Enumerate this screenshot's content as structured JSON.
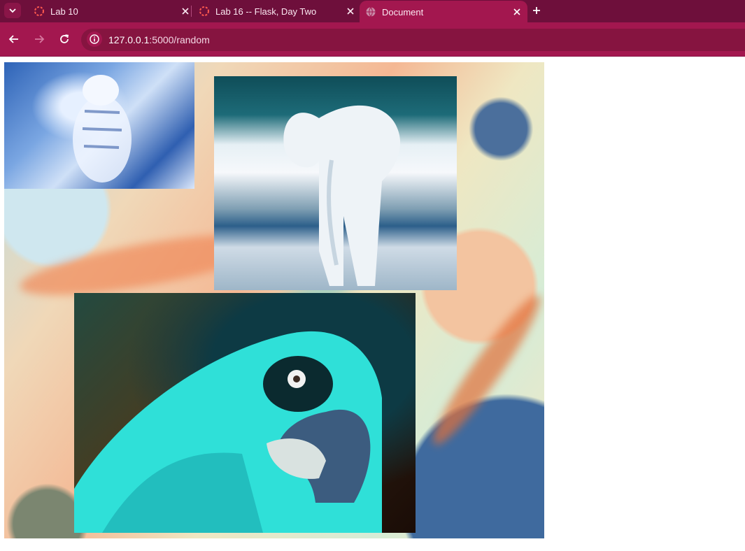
{
  "browser": {
    "tabs": [
      {
        "title": "Lab 10",
        "active": false,
        "favicon": "loading-ring-icon"
      },
      {
        "title": "Lab 16 -- Flask, Day Two",
        "active": false,
        "favicon": "loading-ring-icon"
      },
      {
        "title": "Document",
        "active": true,
        "favicon": "globe-icon"
      }
    ],
    "address": {
      "host": "127.0.0.1",
      "path": ":5000/random"
    },
    "colors": {
      "tabbar": "#6e0f3b",
      "toolbar": "#a3174f",
      "omnibox": "#861440"
    }
  },
  "page": {
    "images": [
      {
        "subject": "tiger"
      },
      {
        "subject": "elephant"
      },
      {
        "subject": "parrot"
      }
    ]
  }
}
